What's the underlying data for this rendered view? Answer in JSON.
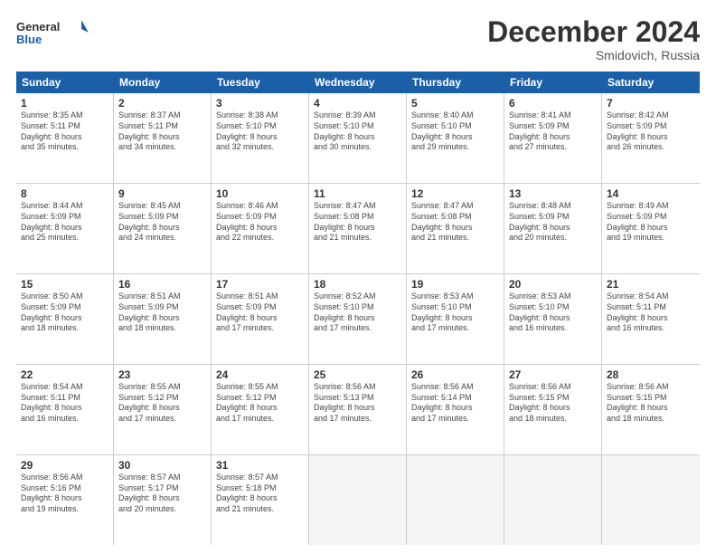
{
  "logo": {
    "line1": "General",
    "line2": "Blue"
  },
  "title": "December 2024",
  "location": "Smidovich, Russia",
  "days_header": [
    "Sunday",
    "Monday",
    "Tuesday",
    "Wednesday",
    "Thursday",
    "Friday",
    "Saturday"
  ],
  "weeks": [
    [
      {
        "day": "1",
        "sunrise": "Sunrise: 8:35 AM",
        "sunset": "Sunset: 5:11 PM",
        "daylight": "Daylight: 8 hours",
        "daylight2": "and 35 minutes."
      },
      {
        "day": "2",
        "sunrise": "Sunrise: 8:37 AM",
        "sunset": "Sunset: 5:11 PM",
        "daylight": "Daylight: 8 hours",
        "daylight2": "and 34 minutes."
      },
      {
        "day": "3",
        "sunrise": "Sunrise: 8:38 AM",
        "sunset": "Sunset: 5:10 PM",
        "daylight": "Daylight: 8 hours",
        "daylight2": "and 32 minutes."
      },
      {
        "day": "4",
        "sunrise": "Sunrise: 8:39 AM",
        "sunset": "Sunset: 5:10 PM",
        "daylight": "Daylight: 8 hours",
        "daylight2": "and 30 minutes."
      },
      {
        "day": "5",
        "sunrise": "Sunrise: 8:40 AM",
        "sunset": "Sunset: 5:10 PM",
        "daylight": "Daylight: 8 hours",
        "daylight2": "and 29 minutes."
      },
      {
        "day": "6",
        "sunrise": "Sunrise: 8:41 AM",
        "sunset": "Sunset: 5:09 PM",
        "daylight": "Daylight: 8 hours",
        "daylight2": "and 27 minutes."
      },
      {
        "day": "7",
        "sunrise": "Sunrise: 8:42 AM",
        "sunset": "Sunset: 5:09 PM",
        "daylight": "Daylight: 8 hours",
        "daylight2": "and 26 minutes."
      }
    ],
    [
      {
        "day": "8",
        "sunrise": "Sunrise: 8:44 AM",
        "sunset": "Sunset: 5:09 PM",
        "daylight": "Daylight: 8 hours",
        "daylight2": "and 25 minutes."
      },
      {
        "day": "9",
        "sunrise": "Sunrise: 8:45 AM",
        "sunset": "Sunset: 5:09 PM",
        "daylight": "Daylight: 8 hours",
        "daylight2": "and 24 minutes."
      },
      {
        "day": "10",
        "sunrise": "Sunrise: 8:46 AM",
        "sunset": "Sunset: 5:09 PM",
        "daylight": "Daylight: 8 hours",
        "daylight2": "and 22 minutes."
      },
      {
        "day": "11",
        "sunrise": "Sunrise: 8:47 AM",
        "sunset": "Sunset: 5:08 PM",
        "daylight": "Daylight: 8 hours",
        "daylight2": "and 21 minutes."
      },
      {
        "day": "12",
        "sunrise": "Sunrise: 8:47 AM",
        "sunset": "Sunset: 5:08 PM",
        "daylight": "Daylight: 8 hours",
        "daylight2": "and 21 minutes."
      },
      {
        "day": "13",
        "sunrise": "Sunrise: 8:48 AM",
        "sunset": "Sunset: 5:09 PM",
        "daylight": "Daylight: 8 hours",
        "daylight2": "and 20 minutes."
      },
      {
        "day": "14",
        "sunrise": "Sunrise: 8:49 AM",
        "sunset": "Sunset: 5:09 PM",
        "daylight": "Daylight: 8 hours",
        "daylight2": "and 19 minutes."
      }
    ],
    [
      {
        "day": "15",
        "sunrise": "Sunrise: 8:50 AM",
        "sunset": "Sunset: 5:09 PM",
        "daylight": "Daylight: 8 hours",
        "daylight2": "and 18 minutes."
      },
      {
        "day": "16",
        "sunrise": "Sunrise: 8:51 AM",
        "sunset": "Sunset: 5:09 PM",
        "daylight": "Daylight: 8 hours",
        "daylight2": "and 18 minutes."
      },
      {
        "day": "17",
        "sunrise": "Sunrise: 8:51 AM",
        "sunset": "Sunset: 5:09 PM",
        "daylight": "Daylight: 8 hours",
        "daylight2": "and 17 minutes."
      },
      {
        "day": "18",
        "sunrise": "Sunrise: 8:52 AM",
        "sunset": "Sunset: 5:10 PM",
        "daylight": "Daylight: 8 hours",
        "daylight2": "and 17 minutes."
      },
      {
        "day": "19",
        "sunrise": "Sunrise: 8:53 AM",
        "sunset": "Sunset: 5:10 PM",
        "daylight": "Daylight: 8 hours",
        "daylight2": "and 17 minutes."
      },
      {
        "day": "20",
        "sunrise": "Sunrise: 8:53 AM",
        "sunset": "Sunset: 5:10 PM",
        "daylight": "Daylight: 8 hours",
        "daylight2": "and 16 minutes."
      },
      {
        "day": "21",
        "sunrise": "Sunrise: 8:54 AM",
        "sunset": "Sunset: 5:11 PM",
        "daylight": "Daylight: 8 hours",
        "daylight2": "and 16 minutes."
      }
    ],
    [
      {
        "day": "22",
        "sunrise": "Sunrise: 8:54 AM",
        "sunset": "Sunset: 5:11 PM",
        "daylight": "Daylight: 8 hours",
        "daylight2": "and 16 minutes."
      },
      {
        "day": "23",
        "sunrise": "Sunrise: 8:55 AM",
        "sunset": "Sunset: 5:12 PM",
        "daylight": "Daylight: 8 hours",
        "daylight2": "and 17 minutes."
      },
      {
        "day": "24",
        "sunrise": "Sunrise: 8:55 AM",
        "sunset": "Sunset: 5:12 PM",
        "daylight": "Daylight: 8 hours",
        "daylight2": "and 17 minutes."
      },
      {
        "day": "25",
        "sunrise": "Sunrise: 8:56 AM",
        "sunset": "Sunset: 5:13 PM",
        "daylight": "Daylight: 8 hours",
        "daylight2": "and 17 minutes."
      },
      {
        "day": "26",
        "sunrise": "Sunrise: 8:56 AM",
        "sunset": "Sunset: 5:14 PM",
        "daylight": "Daylight: 8 hours",
        "daylight2": "and 17 minutes."
      },
      {
        "day": "27",
        "sunrise": "Sunrise: 8:56 AM",
        "sunset": "Sunset: 5:15 PM",
        "daylight": "Daylight: 8 hours",
        "daylight2": "and 18 minutes."
      },
      {
        "day": "28",
        "sunrise": "Sunrise: 8:56 AM",
        "sunset": "Sunset: 5:15 PM",
        "daylight": "Daylight: 8 hours",
        "daylight2": "and 18 minutes."
      }
    ],
    [
      {
        "day": "29",
        "sunrise": "Sunrise: 8:56 AM",
        "sunset": "Sunset: 5:16 PM",
        "daylight": "Daylight: 8 hours",
        "daylight2": "and 19 minutes."
      },
      {
        "day": "30",
        "sunrise": "Sunrise: 8:57 AM",
        "sunset": "Sunset: 5:17 PM",
        "daylight": "Daylight: 8 hours",
        "daylight2": "and 20 minutes."
      },
      {
        "day": "31",
        "sunrise": "Sunrise: 8:57 AM",
        "sunset": "Sunset: 5:18 PM",
        "daylight": "Daylight: 8 hours",
        "daylight2": "and 21 minutes."
      },
      null,
      null,
      null,
      null
    ]
  ]
}
